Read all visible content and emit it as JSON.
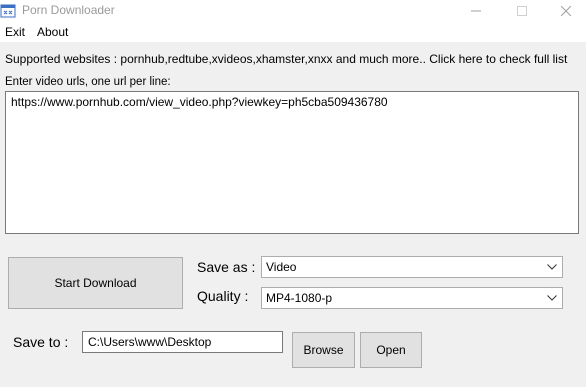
{
  "window": {
    "title": "Porn Downloader",
    "icon": "app-icon"
  },
  "menu": {
    "exit": "Exit",
    "about": "About"
  },
  "supported_text": "Supported websites : pornhub,redtube,xvideos,xhamster,xnxx and much more.. Click here to check full list",
  "url_label": "Enter video urls, one url per line:",
  "url_value": "https://www.pornhub.com/view_video.php?viewkey=ph5cba509436780",
  "start_button": "Start Download",
  "save_as": {
    "label": "Save as :",
    "value": "Video"
  },
  "quality": {
    "label": "Quality :",
    "value": "MP4-1080-p"
  },
  "save_to": {
    "label": "Save to :",
    "value": "C:\\Users\\www\\Desktop"
  },
  "browse_button": "Browse",
  "open_button": "Open",
  "colors": {
    "background": "#f0f0f0",
    "button_face": "#e1e1e1",
    "title_text": "#9a9a9a"
  }
}
